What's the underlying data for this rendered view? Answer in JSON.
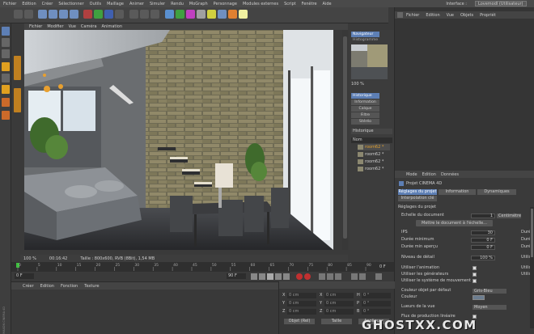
{
  "menubar": {
    "items": [
      "Fichier",
      "Edition",
      "Créer",
      "Sélectionner",
      "Outils",
      "Maillage",
      "Animer",
      "Simuler",
      "Rendu",
      "MoGraph",
      "Personnage",
      "Modules externes",
      "Script",
      "Fenêtre",
      "Aide"
    ],
    "interface_label": "Interface :",
    "interface_value": "Lovemodl (Utilisateur)"
  },
  "viewport": {
    "menu": [
      "Fichier",
      "Modifier",
      "Vue",
      "Caméra",
      "Animation"
    ],
    "zoom": "100 %",
    "status_time": "00:16:42",
    "status_info": "Taille : 800x600, RVB (8Bit), 1,54 MB"
  },
  "navigator": {
    "tab_active": "Navigateur",
    "tab2": "Histogramme",
    "zoom": "100 %",
    "tabs": [
      "Historique",
      "Information",
      "Calque",
      "Filtre",
      "Stéréo"
    ],
    "history_title": "Historique",
    "col_name": "Nom",
    "items": [
      "room62 *",
      "room62 *",
      "room62 *",
      "room62 *"
    ]
  },
  "objects": {
    "menu": [
      "Fichier",
      "Edition",
      "Vue",
      "Objets",
      "Propriét"
    ]
  },
  "attributes": {
    "menu": [
      "Mode",
      "Edition",
      "Données"
    ],
    "project_title": "Projet CINEMA 4D",
    "tabs": [
      "Réglages du projet",
      "Information",
      "Dynamiques"
    ],
    "tab_interp": "Interpolation clé",
    "section": "Réglages du projet",
    "scale_label": "Echelle du document",
    "scale_val": "1",
    "scale_unit": "Centimètre",
    "scale_button": "Mettre le document à l'échelle...",
    "fields": [
      {
        "label": "IPS",
        "value": "30",
        "unit": "Duré"
      },
      {
        "label": "Durée minimum",
        "value": "0 F",
        "unit": "Duré"
      },
      {
        "label": "Durée min aperçu",
        "value": "0 F",
        "unit": "Duré"
      }
    ],
    "lod_label": "Niveau de détail",
    "lod_value": "100 %",
    "lod_unit": "Utilis",
    "checks": [
      {
        "label": "Utiliser l'animation",
        "unit": "Utilis"
      },
      {
        "label": "Utiliser les générateurs",
        "unit": "Utilis"
      },
      {
        "label": "Utiliser le système de mouvement",
        "unit": ""
      }
    ],
    "color_label": "Couleur objet par défaut",
    "color_value": "Gris-Bleu",
    "couleur_label": "Couleur",
    "lod_view_label": "Lueurs de la vue",
    "lod_view_value": "Moyen",
    "flux_label": "Flux de production linéaire"
  },
  "timeline": {
    "start": "0",
    "ticks": [
      "0",
      "5",
      "10",
      "15",
      "20",
      "25",
      "30",
      "35",
      "40",
      "45",
      "50",
      "55",
      "60",
      "65",
      "70",
      "75",
      "80",
      "85",
      "90"
    ],
    "end_frame": "0 F",
    "frame_a": "0 F",
    "frame_b": "90 F",
    "frame_c": "90 F"
  },
  "materials": {
    "menu": [
      "Créer",
      "Edition",
      "Fonction",
      "Texture"
    ]
  },
  "coords": {
    "rows": [
      [
        "X",
        "0 cm",
        "X",
        "0 cm",
        "H",
        "0 °"
      ],
      [
        "Y",
        "0 cm",
        "Y",
        "0 cm",
        "P",
        "0 °"
      ],
      [
        "Z",
        "0 cm",
        "Z",
        "0 cm",
        "B",
        "0 °"
      ]
    ],
    "btn1": "Objet (Rel)",
    "btn2": "Taille",
    "btn3": "Appliquer"
  },
  "left_label": "MAXON CINEMA 4D",
  "watermark": "GHOSTXX.COM",
  "colors": {
    "accent": "#5d7fb5",
    "tool_orange": "#e0a020"
  }
}
